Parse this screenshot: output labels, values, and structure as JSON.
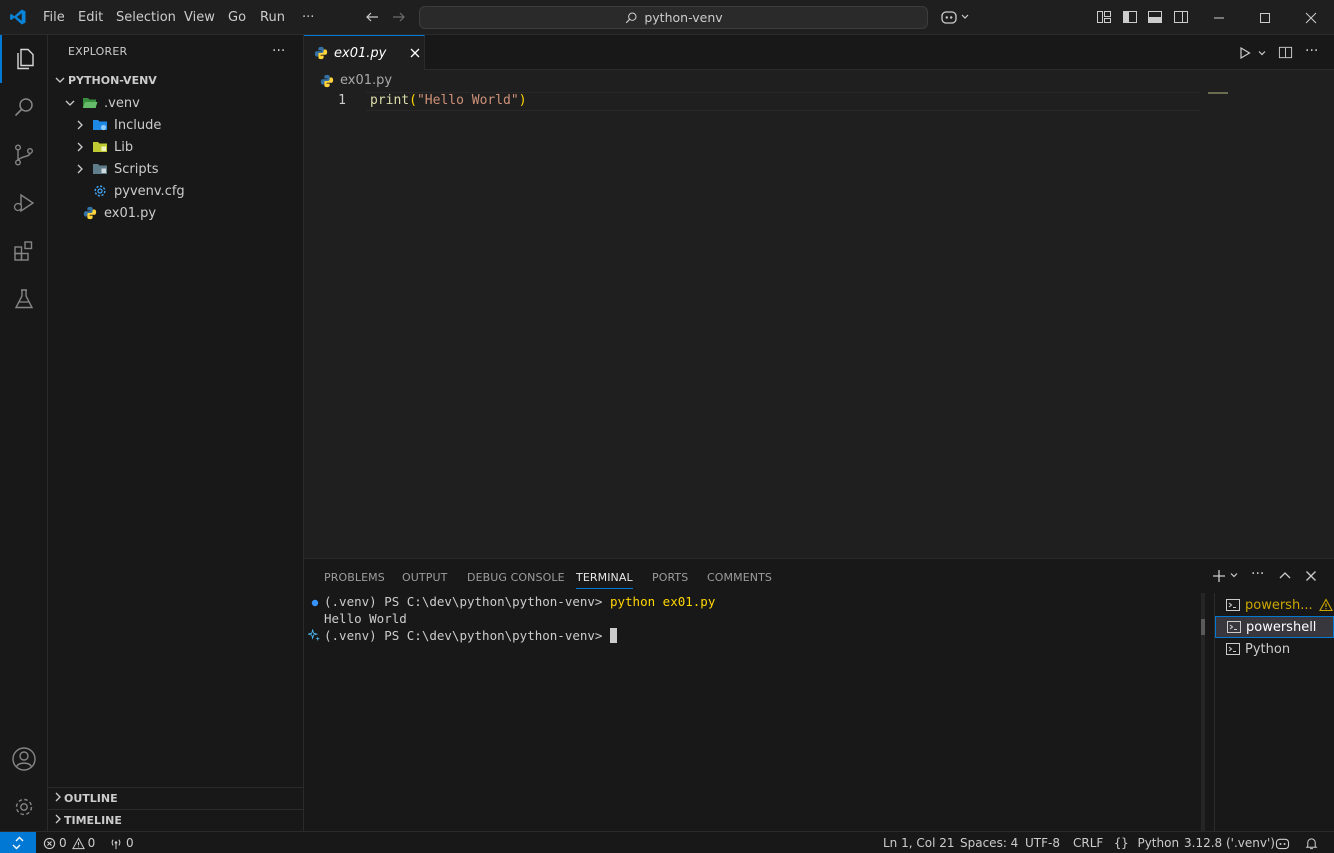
{
  "colors": {
    "accent": "#0078d4",
    "python_blue": "#3572a5",
    "python_yellow": "#ffd43b",
    "folder_green": "#4caf50",
    "warning": "#cca700"
  },
  "menu": [
    "File",
    "Edit",
    "Selection",
    "View",
    "Go",
    "Run",
    "···"
  ],
  "command_center": {
    "text": "python-venv"
  },
  "sidebar": {
    "title": "EXPLORER",
    "more": "···",
    "root": "PYTHON-VENV",
    "tree": [
      ".venv",
      "Include",
      "Lib",
      "Scripts",
      "pyvenv.cfg",
      "ex01.py"
    ],
    "outline": "OUTLINE",
    "timeline": "TIMELINE"
  },
  "editor": {
    "tab": "ex01.py",
    "breadcrumb": "ex01.py",
    "line_number": "1",
    "code": {
      "fn": "print",
      "open": "(",
      "str": "\"Hello World\"",
      "close": ")"
    }
  },
  "panel": {
    "tabs": [
      "PROBLEMS",
      "OUTPUT",
      "DEBUG CONSOLE",
      "TERMINAL",
      "PORTS",
      "COMMENTS"
    ],
    "terminal_lines": {
      "l1_prompt": "(.venv) PS C:\\dev\\python\\python-venv> ",
      "l1_cmd": "python ex01.py",
      "l2": "Hello World",
      "l3_prompt": "(.venv) PS C:\\dev\\python\\python-venv> "
    },
    "terminals": [
      "powersh...",
      "powershell",
      "Python"
    ]
  },
  "status": {
    "errors": "0",
    "warnings": "0",
    "ports": "0",
    "position": "Ln 1, Col 21",
    "spaces": "Spaces: 4",
    "encoding": "UTF-8",
    "eol": "CRLF",
    "language": "Python",
    "interpreter": "3.12.8 ('.venv')"
  }
}
